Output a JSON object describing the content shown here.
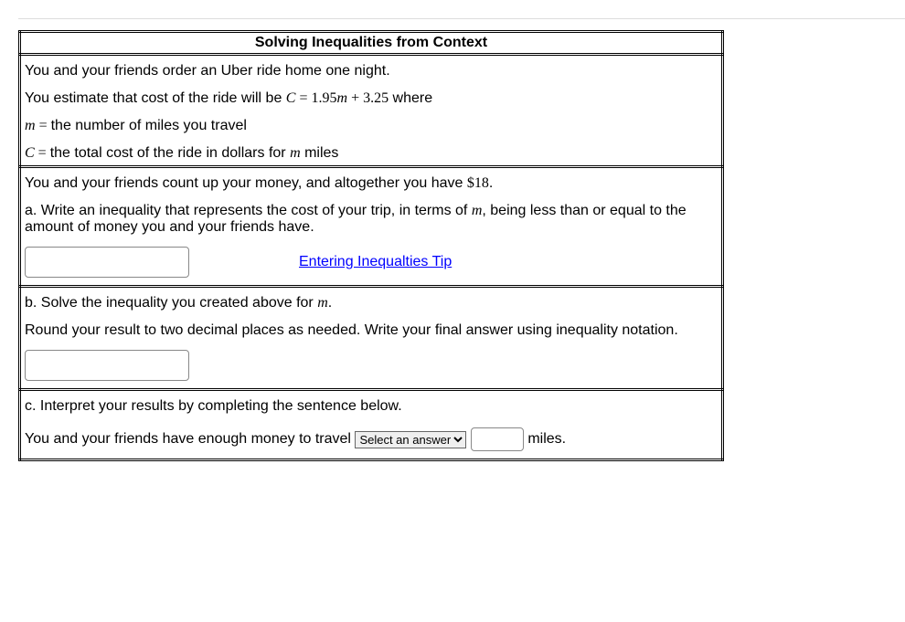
{
  "header": "Solving Inequalities from Context",
  "setup": {
    "line1": "You and your friends order an Uber ride home one night.",
    "line2a": "You estimate that cost of the ride will be ",
    "equation": "C = 1.95m + 3.25",
    "line2b": " where",
    "mdef_lhs": "m = ",
    "mdef_rhs": " the number of miles you travel",
    "cdef_lhs": "C = ",
    "cdef_rhs": " the total cost of the ride in dollars for ",
    "cdef_var": "m",
    "cdef_tail": " miles"
  },
  "partA": {
    "count_text_a": "You and your friends count up your money, and altogether you have ",
    "money": "$18",
    "count_text_b": ".",
    "prompt_a": "a. Write an inequality that represents the cost of your trip, in terms of ",
    "prompt_var": "m",
    "prompt_b": ", being less than or equal to the amount of money you and your friends have.",
    "tip_label": "Entering Inequalties Tip"
  },
  "partB": {
    "line1a": "b. Solve the inequality you created above for ",
    "line1var": "m",
    "line1b": ".",
    "line2": "Round your result to two decimal places as needed. Write your final answer using inequality notation."
  },
  "partC": {
    "prompt": "c. Interpret your results by completing the sentence below.",
    "sentence_a": "You and your friends have enough money to travel ",
    "select_placeholder": "Select an answer",
    "sentence_b": " miles."
  }
}
